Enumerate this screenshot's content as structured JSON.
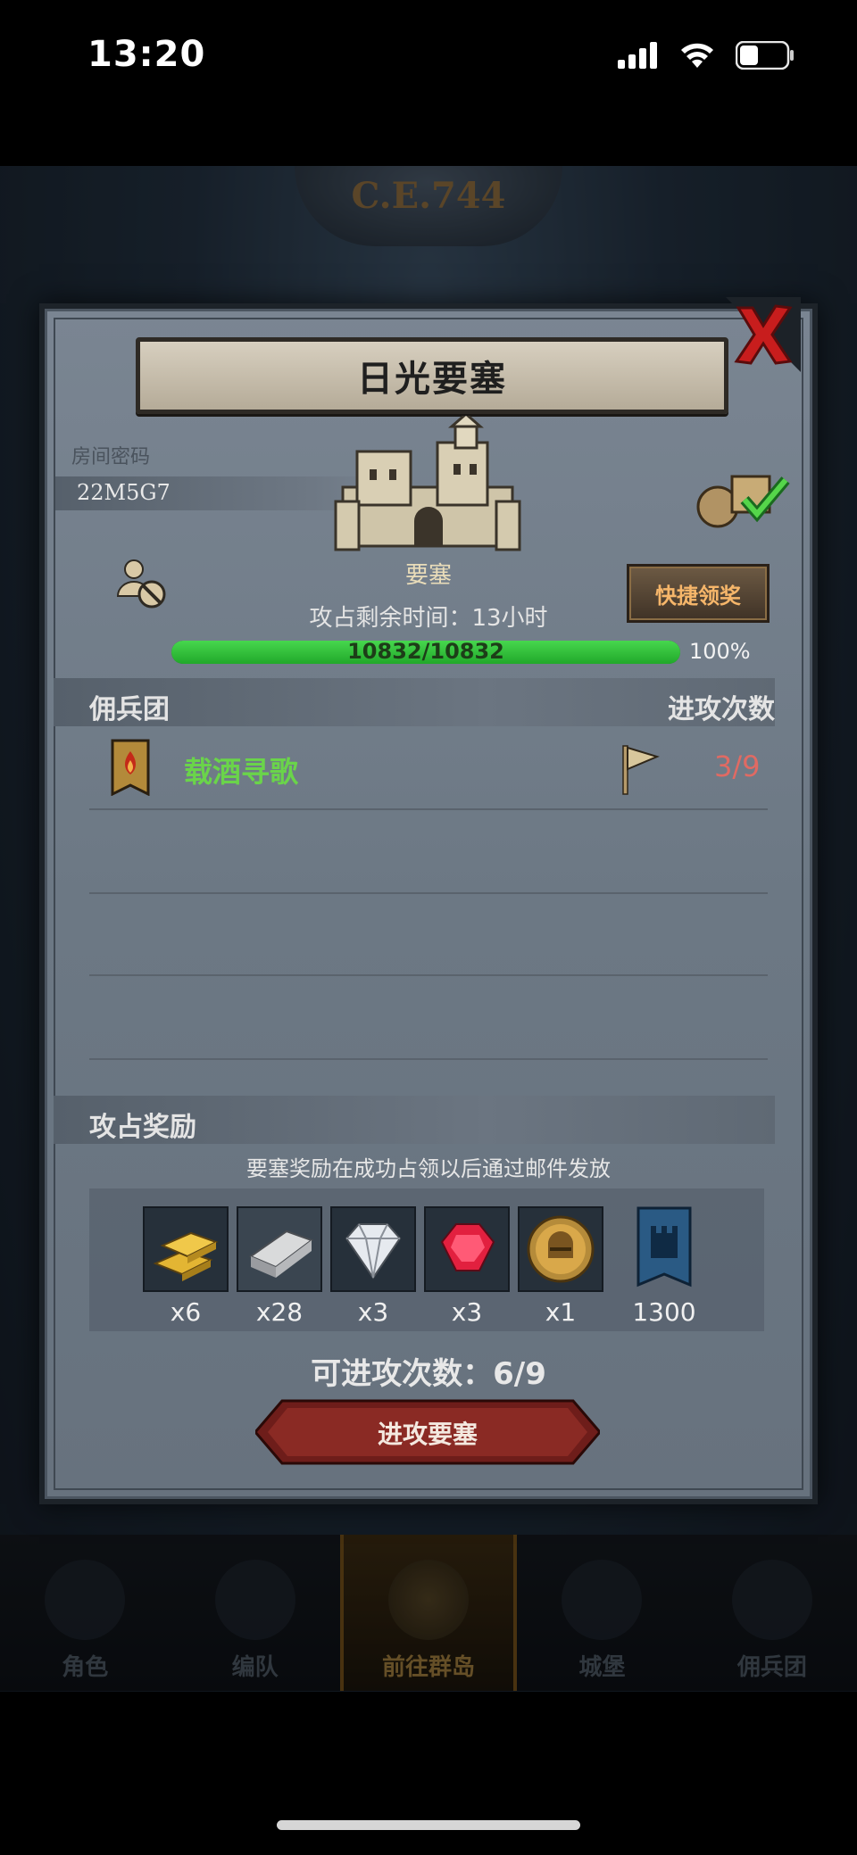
{
  "status_bar": {
    "time": "13:20"
  },
  "background": {
    "era_banner": "C.E.744"
  },
  "modal": {
    "title": "日光要塞",
    "room_code_label": "房间密码",
    "room_code": "22M5G7",
    "fortress_label": "要塞",
    "quick_claim_label": "快捷领奖",
    "time_remaining": "攻占剩余时间：13小时",
    "progress": {
      "text": "10832/10832",
      "percent": "100%",
      "fraction": 1.0
    },
    "mercenary_section": {
      "title": "佣兵团",
      "right_label": "进攻次数"
    },
    "team": {
      "name": "载酒寻歌",
      "attacks": "3/9"
    },
    "reward_section": {
      "title": "攻占奖励",
      "note": "要塞奖励在成功占领以后通过邮件发放"
    },
    "rewards": [
      {
        "icon": "gold-bars-icon",
        "count": "x6"
      },
      {
        "icon": "iron-ingot-icon",
        "count": "x28"
      },
      {
        "icon": "diamond-icon",
        "count": "x3"
      },
      {
        "icon": "ruby-icon",
        "count": "x3"
      },
      {
        "icon": "helmet-medal-icon",
        "count": "x1"
      },
      {
        "icon": "fortress-banner-icon",
        "count": "1300"
      }
    ],
    "attack_count": "可进攻次数：6/9",
    "attack_button_label": "进攻要塞"
  },
  "bottom_nav": [
    {
      "label": "角色",
      "active": false
    },
    {
      "label": "编队",
      "active": false
    },
    {
      "label": "前往群岛",
      "active": true
    },
    {
      "label": "城堡",
      "active": false
    },
    {
      "label": "佣兵团",
      "active": false
    }
  ],
  "colors": {
    "team_name": "#6ad44a",
    "attacks_red": "#e06a63",
    "quick_claim_text": "#f6b66a",
    "progress_green": "#2fbf38"
  }
}
